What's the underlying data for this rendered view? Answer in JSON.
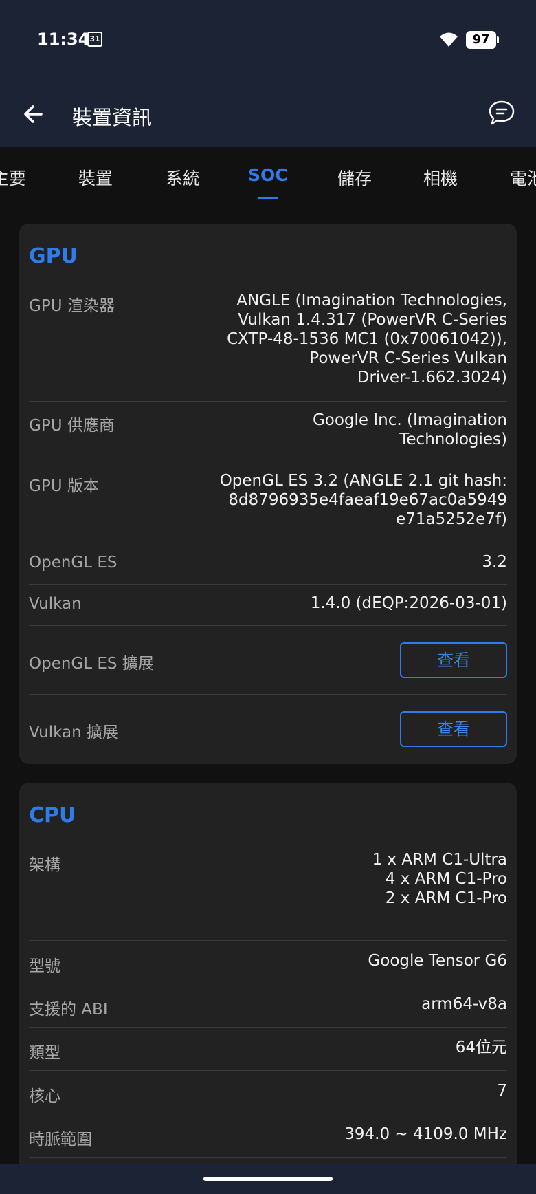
{
  "status_bar": {
    "time": "11:34",
    "calendar_day": "31",
    "battery": "97"
  },
  "app_bar": {
    "title": "裝置資訊"
  },
  "tabs": [
    "主要",
    "裝置",
    "系統",
    "SOC",
    "儲存",
    "相機",
    "電池"
  ],
  "active_tab": "SOC",
  "gpu": {
    "title": "GPU",
    "renderer_label": "GPU 渲染器",
    "renderer_lines": [
      "ANGLE (Imagination Technologies,",
      "Vulkan 1.4.317 (PowerVR C-Series",
      "CXTP-48-1536 MC1 (0x70061042)),",
      "PowerVR C-Series Vulkan",
      "Driver-1.662.3024)"
    ],
    "vendor_label": "GPU 供應商",
    "vendor_lines": [
      "Google Inc. (Imagination",
      "Technologies)"
    ],
    "version_label": "GPU 版本",
    "version_lines": [
      "OpenGL ES 3.2 (ANGLE 2.1 git hash:",
      "8d8796935e4faeaf19e67ac0a5949",
      "e71a5252e7f)"
    ],
    "opengl_label": "OpenGL ES",
    "opengl_value": "3.2",
    "vulkan_label": "Vulkan",
    "vulkan_value": "1.4.0 (dEQP:2026-03-01)",
    "opengl_ext_label": "OpenGL ES 擴展",
    "vulkan_ext_label": "Vulkan 擴展",
    "view_button": "查看"
  },
  "cpu": {
    "title": "CPU",
    "arch_label": "架構",
    "arch_lines": [
      "1 x ARM C1-Ultra",
      "4 x ARM C1-Pro",
      "2 x ARM C1-Pro"
    ],
    "model_label": "型號",
    "model_value": "Google Tensor G6",
    "abi_label": "支援的 ABI",
    "abi_value": "arm64-v8a",
    "type_label": "類型",
    "type_value": "64位元",
    "cores_label": "核心",
    "cores_value": "7",
    "clock_label": "時脈範圍",
    "clock_value": "394.0 ~ 4109.0 MHz"
  },
  "colors": {
    "accent": "#2f7bea",
    "bar_bg": "#1b2335",
    "card_bg": "#222222",
    "page_bg": "#111111"
  }
}
